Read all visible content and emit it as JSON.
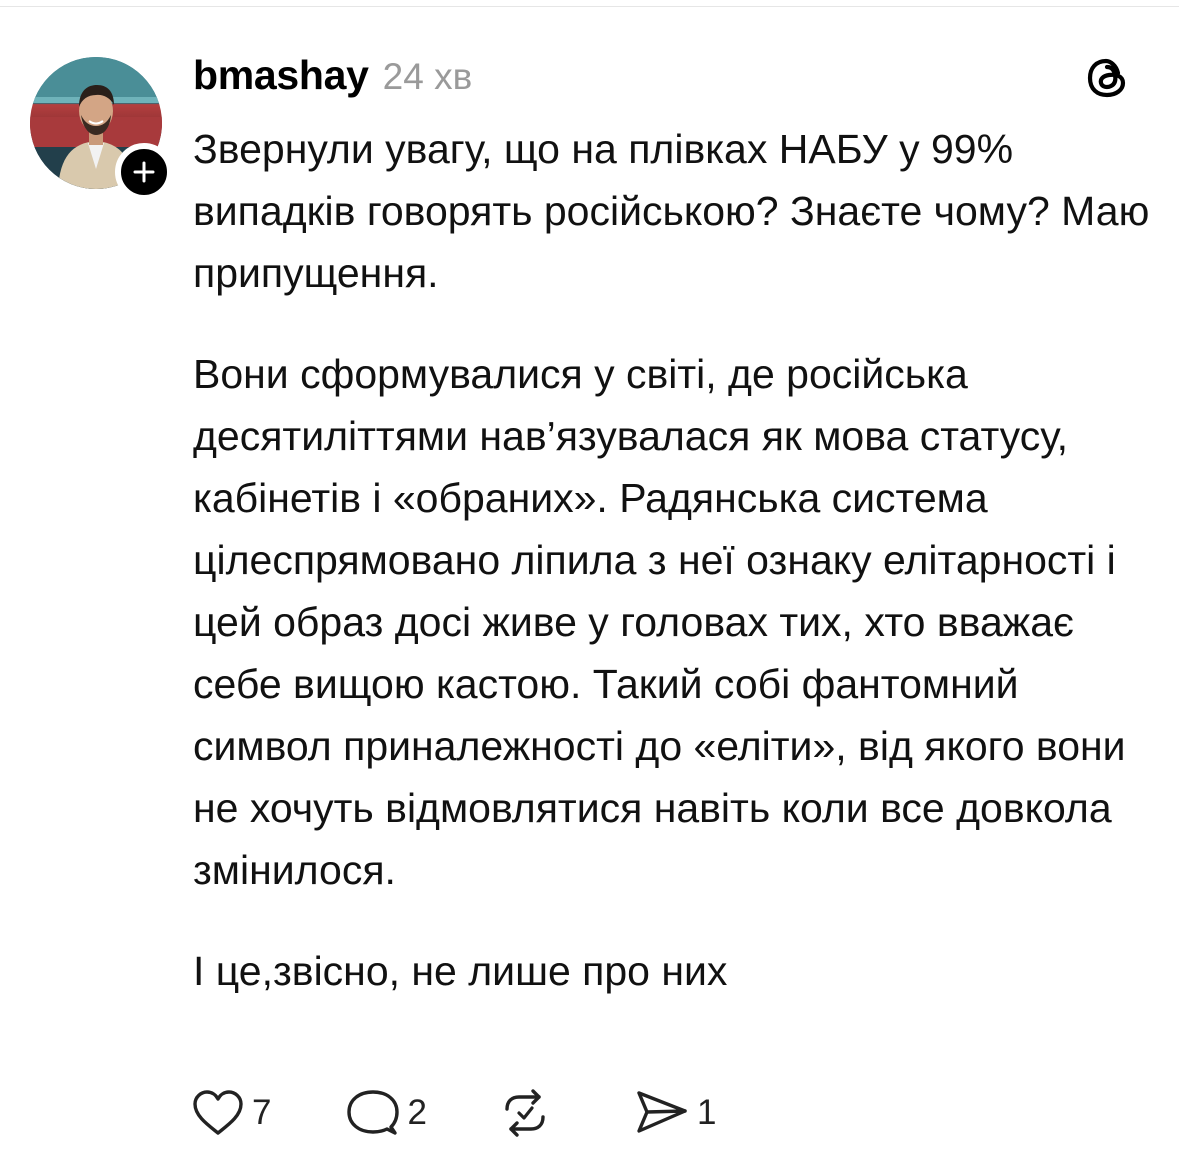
{
  "post": {
    "username": "bmashay",
    "timestamp": "24 хв",
    "paragraphs": [
      "Звернули увагу, що на плівках НАБУ у 99% випадків говорять російською? Знаєте чому? Маю припущення.",
      "Вони сформувалися у світі, де російська десятиліттями нав’язувалася як мова статусу, кабінетів і «обраних». Радянська система цілеспрямовано ліпила з неї ознаку елітарності і цей образ досі живе у головах тих, хто вважає себе вищою кастою. Такий собі фантомний символ приналежності до «еліти», від якого вони не хочуть відмовлятися навіть коли все довкола змінилося.",
      "І це,звісно, не лише про них"
    ],
    "likes": "7",
    "replies": "2",
    "shares": "1"
  },
  "icons": {
    "avatar": "avatar",
    "follow": "plus-icon",
    "logo": "threads-logo-icon",
    "like": "heart-icon",
    "reply": "speech-bubble-icon",
    "repost": "repost-icon",
    "share": "send-icon"
  },
  "colors": {
    "text": "#000000",
    "muted": "#9a9a9a",
    "background": "#ffffff"
  }
}
